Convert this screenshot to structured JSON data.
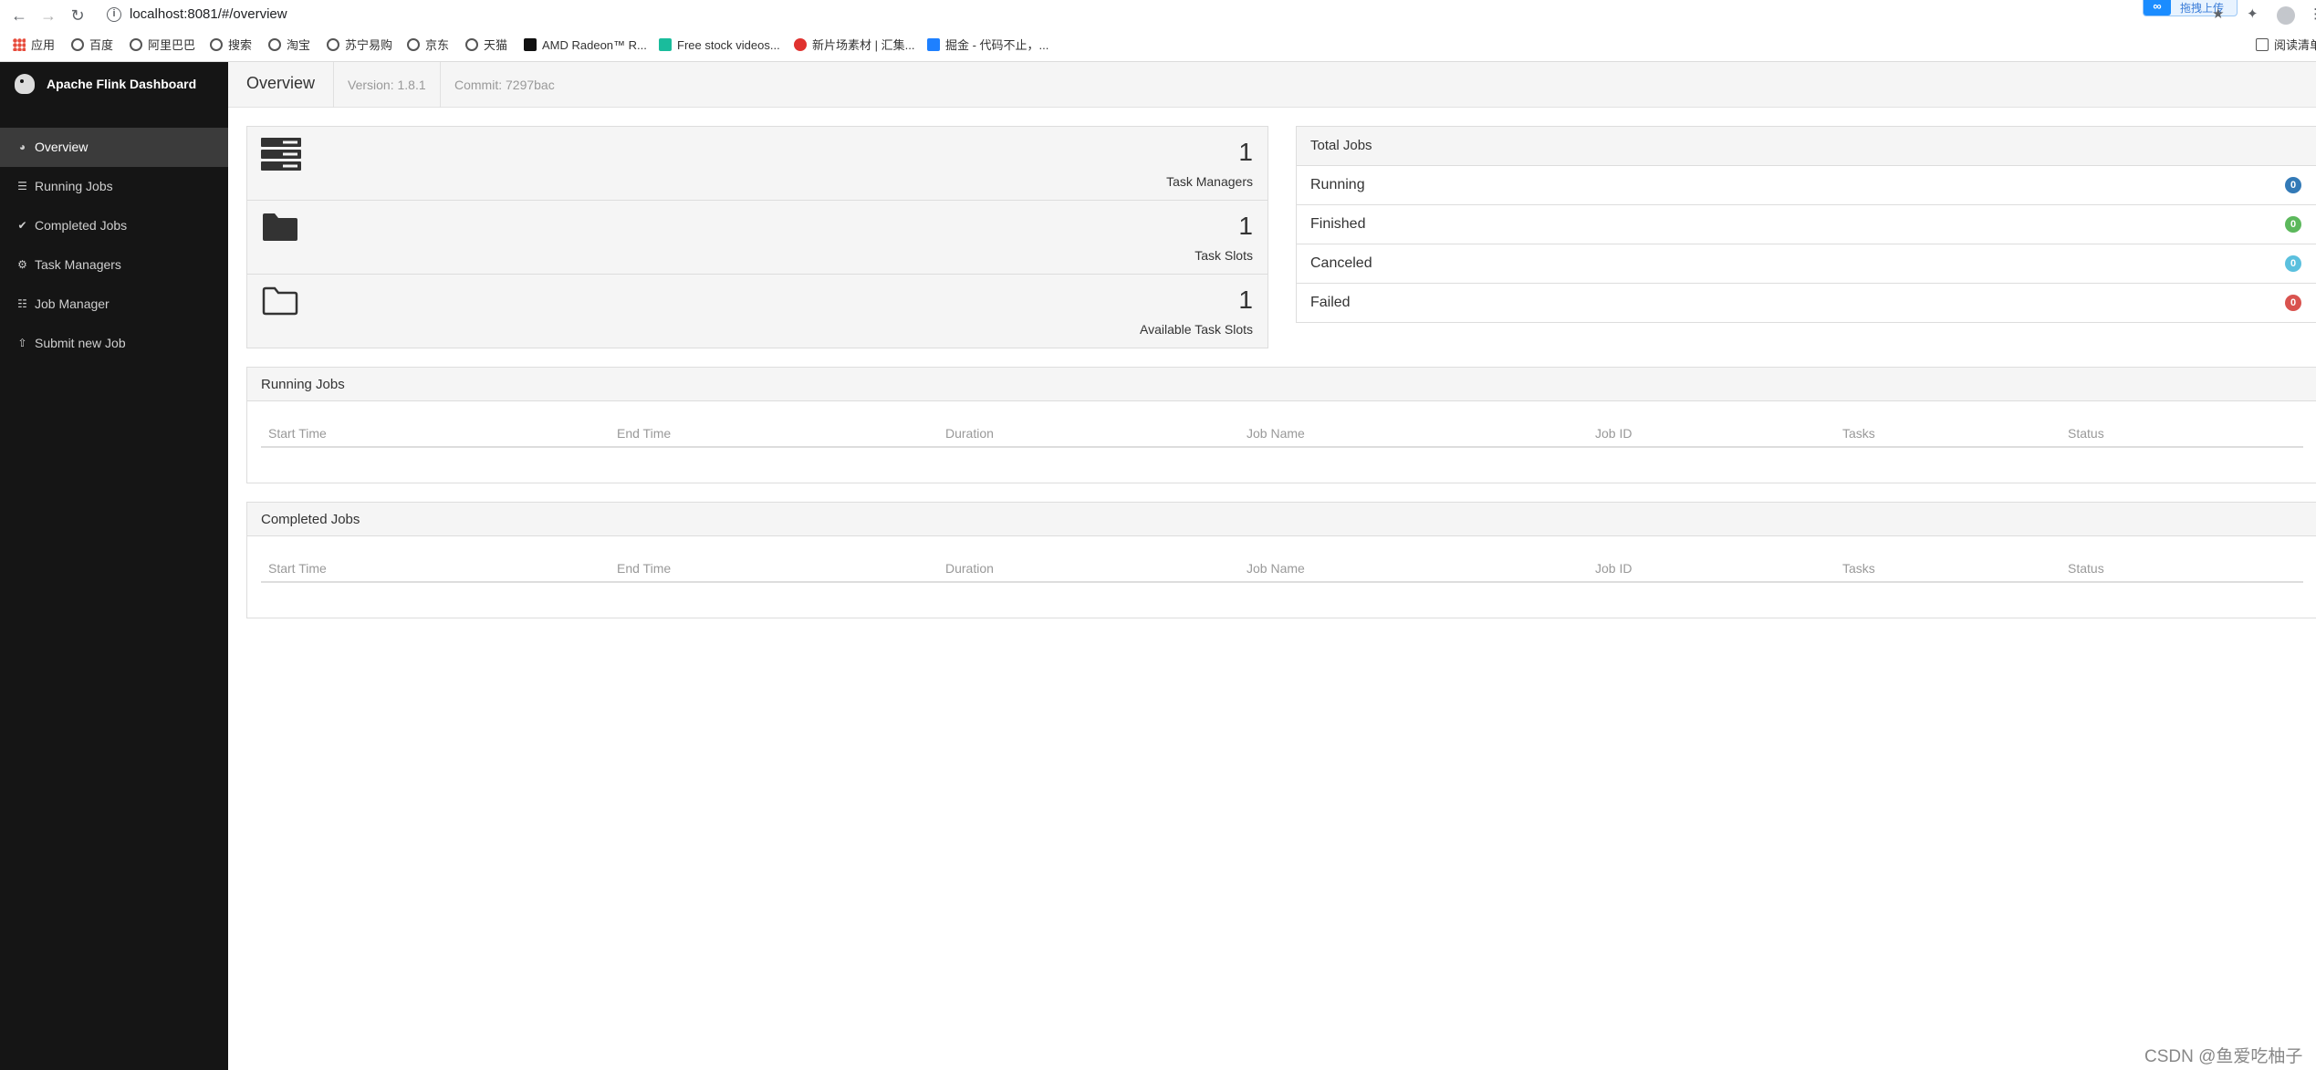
{
  "browser": {
    "url": "localhost:8081/#/overview",
    "upload_chip": "拖拽上传",
    "reading_list": "阅读清单",
    "bookmarks": [
      "应用",
      "百度",
      "阿里巴巴",
      "搜索",
      "淘宝",
      "苏宁易购",
      "京东",
      "天猫",
      "AMD Radeon™ R...",
      "Free stock videos...",
      "新片场素材 | 汇集...",
      "掘金 - 代码不止，..."
    ]
  },
  "sidebar": {
    "brand": "Apache Flink Dashboard",
    "items": [
      {
        "label": "Overview",
        "icon": "dashboard-icon"
      },
      {
        "label": "Running Jobs",
        "icon": "tasks-icon"
      },
      {
        "label": "Completed Jobs",
        "icon": "check-circle-icon"
      },
      {
        "label": "Task Managers",
        "icon": "sitemap-icon"
      },
      {
        "label": "Job Manager",
        "icon": "list-icon"
      },
      {
        "label": "Submit new Job",
        "icon": "upload-icon"
      }
    ]
  },
  "header": {
    "title": "Overview",
    "version": "Version: 1.8.1",
    "commit": "Commit: 7297bac"
  },
  "stats": [
    {
      "value": "1",
      "label": "Task Managers",
      "icon": "server-icon"
    },
    {
      "value": "1",
      "label": "Task Slots",
      "icon": "folder-icon"
    },
    {
      "value": "1",
      "label": "Available Task Slots",
      "icon": "folder-open-icon"
    }
  ],
  "total_jobs": {
    "title": "Total Jobs",
    "rows": [
      {
        "label": "Running",
        "count": "0",
        "color": "#337ab7"
      },
      {
        "label": "Finished",
        "count": "0",
        "color": "#5cb85c"
      },
      {
        "label": "Canceled",
        "count": "0",
        "color": "#5bc0de"
      },
      {
        "label": "Failed",
        "count": "0",
        "color": "#d9534f"
      }
    ]
  },
  "running_jobs": {
    "title": "Running Jobs",
    "columns": [
      "Start Time",
      "End Time",
      "Duration",
      "Job Name",
      "Job ID",
      "Tasks",
      "Status"
    ]
  },
  "completed_jobs": {
    "title": "Completed Jobs",
    "columns": [
      "Start Time",
      "End Time",
      "Duration",
      "Job Name",
      "Job ID",
      "Tasks",
      "Status"
    ]
  },
  "watermark": "CSDN @鱼爱吃柚子"
}
